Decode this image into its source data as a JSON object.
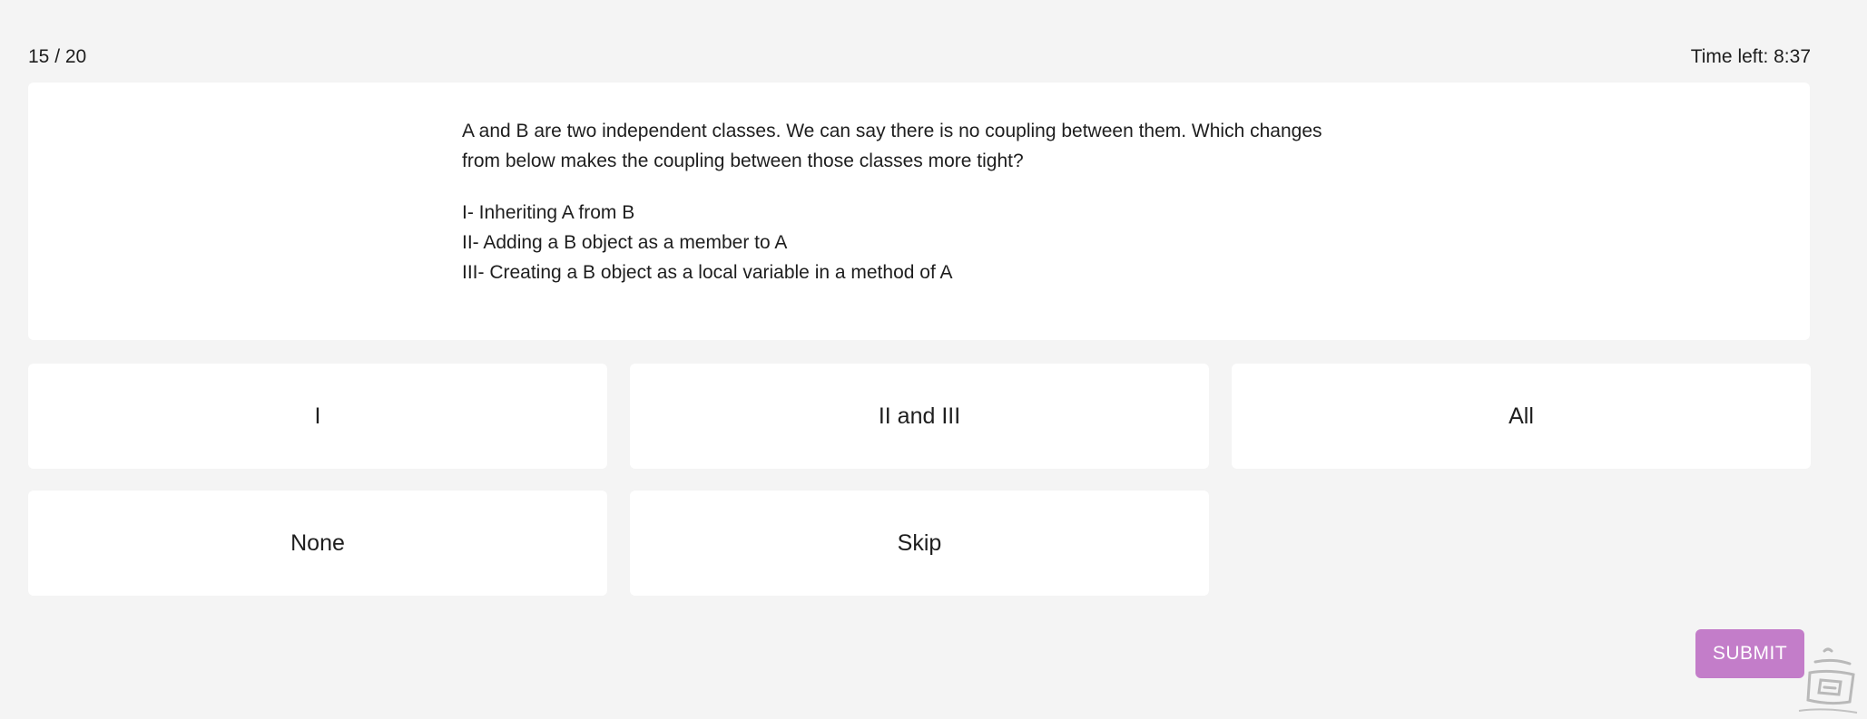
{
  "header": {
    "progress": "15 / 20",
    "timer": "Time left: 8:37"
  },
  "question": {
    "text": "A and B are two independent classes. We can say there is no coupling between them. Which changes from below makes the coupling between those classes more tight?",
    "statements": [
      "I- Inheriting A from B",
      "II- Adding a B object as a member to A",
      "III- Creating a B object as a local variable in a method of A"
    ]
  },
  "options": [
    "I",
    "II and III",
    "All",
    "None",
    "Skip"
  ],
  "submit_label": "SUBMIT",
  "colors": {
    "background": "#f4f4f4",
    "card": "#ffffff",
    "submit": "#c37dc9"
  },
  "watermark_icon": "watermark-logo-icon"
}
